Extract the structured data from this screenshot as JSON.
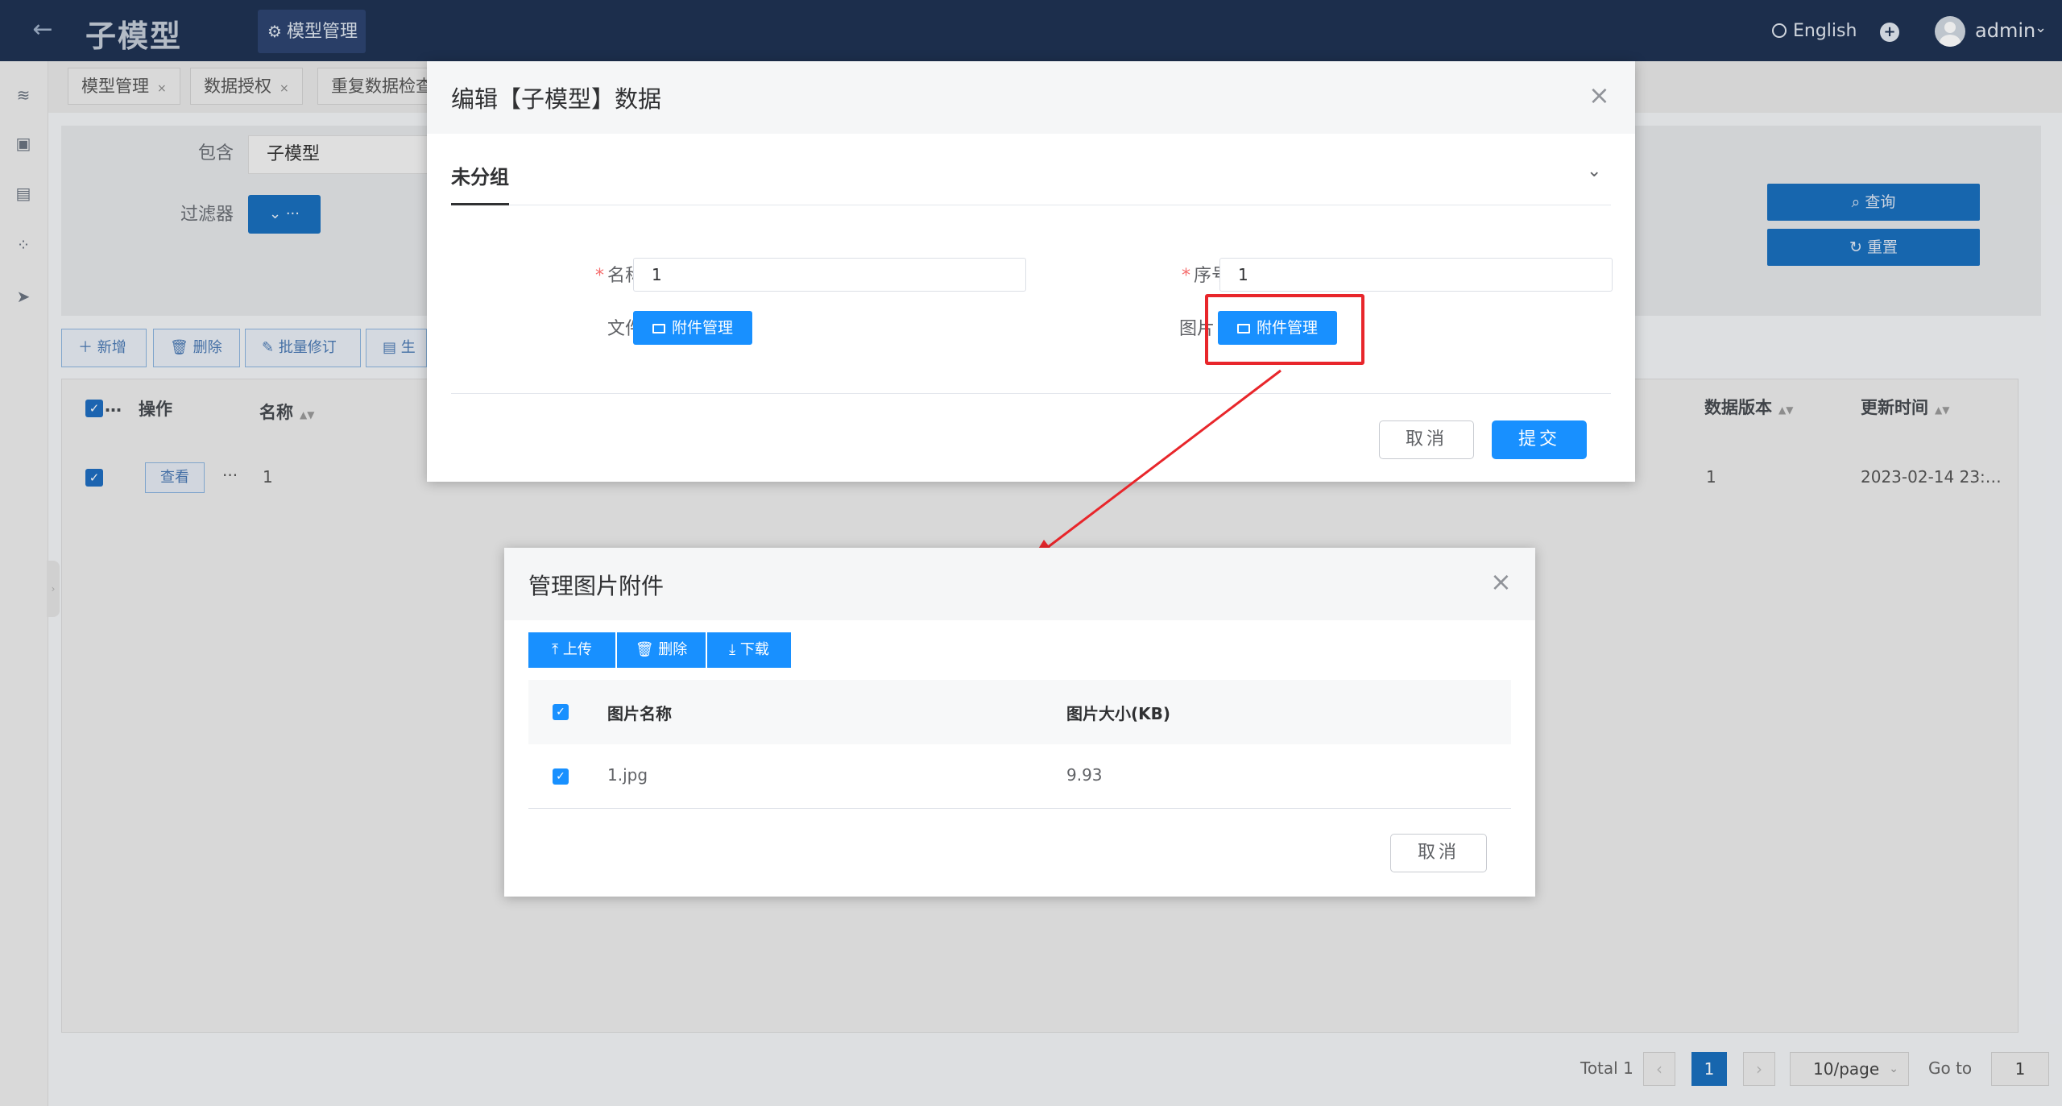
{
  "header": {
    "app_title": "子模型",
    "nav_tab": "模型管理",
    "language": "English",
    "user": "admin"
  },
  "tabs": [
    {
      "label": "模型管理"
    },
    {
      "label": "数据授权"
    },
    {
      "label": "重复数据检查"
    }
  ],
  "search": {
    "contains_label": "包含",
    "contains_value": "子模型",
    "filter_label": "过滤器",
    "filter_button": "⌄ ···",
    "query_button": "查询",
    "reset_button": "重置"
  },
  "toolbar": {
    "add": "新增",
    "delete": "删除",
    "batch_edit": "批量修订",
    "generate": "生"
  },
  "table": {
    "select_all_label": "…",
    "headers": {
      "action": "操作",
      "name": "名称",
      "data_version": "数据版本",
      "updated_time": "更新时间"
    },
    "row": {
      "view_button": "查看",
      "more": "···",
      "name": "1",
      "data_version": "1",
      "updated_time": "2023-02-14 23:…"
    }
  },
  "pagination": {
    "total": "Total 1",
    "current_page": "1",
    "page_size": "10/page",
    "goto_label": "Go to",
    "goto_value": "1"
  },
  "edit_dialog": {
    "title": "编辑【子模型】数据",
    "group_title": "未分组",
    "name_label": "名称",
    "name_value": "1",
    "seq_label": "序号",
    "seq_value": "1",
    "file_label": "文件",
    "image_label": "图片",
    "attachment_button": "附件管理",
    "cancel": "取消",
    "submit": "提交"
  },
  "image_dialog": {
    "title": "管理图片附件",
    "upload": "上传",
    "delete": "删除",
    "download": "下载",
    "col_name": "图片名称",
    "col_size": "图片大小(KB)",
    "rows": [
      {
        "name": "1.jpg",
        "size": "9.93"
      }
    ],
    "cancel": "取消"
  },
  "colors": {
    "header_bg": "#1f3253",
    "primary": "#1890ff",
    "highlight": "#e8262b"
  }
}
